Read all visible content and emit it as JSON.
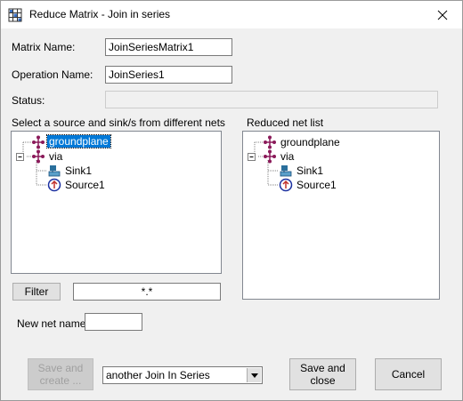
{
  "window": {
    "title": "Reduce Matrix - Join in series",
    "app_icon": "matrix-grid-icon",
    "close_icon": "close-icon"
  },
  "form": {
    "matrix_name_label": "Matrix Name:",
    "matrix_name_value": "JoinSeriesMatrix1",
    "operation_name_label": "Operation Name:",
    "operation_name_value": "JoinSeries1",
    "status_label": "Status:",
    "status_value": ""
  },
  "source_panel": {
    "heading": "Select a source and sink/s from different nets",
    "nodes": [
      {
        "label": "groundplane",
        "icon": "net-icon",
        "selected": true
      },
      {
        "label": "via",
        "icon": "net-icon",
        "expanded": true
      },
      {
        "label": "Sink1",
        "icon": "sink-icon"
      },
      {
        "label": "Source1",
        "icon": "source-icon"
      }
    ]
  },
  "reduced_panel": {
    "heading": "Reduced net list",
    "nodes": [
      {
        "label": "groundplane",
        "icon": "net-icon"
      },
      {
        "label": "via",
        "icon": "net-icon",
        "expanded": true
      },
      {
        "label": "Sink1",
        "icon": "sink-icon"
      },
      {
        "label": "Source1",
        "icon": "source-icon"
      }
    ]
  },
  "filter": {
    "button_label": "Filter",
    "value": "*.*"
  },
  "new_net": {
    "label": "New net name:",
    "value": ""
  },
  "actions": {
    "save_create_label_line1": "Save and",
    "save_create_label_line2": "create ...",
    "operation_select_value": "another Join In Series",
    "save_close_label_line1": "Save and",
    "save_close_label_line2": "close",
    "cancel_label": "Cancel"
  },
  "colors": {
    "selection": "#0078d7",
    "net_icon": "#8b1a5a",
    "source_icon": "#1a2fa0",
    "sink_icon": "#2a6f9c"
  }
}
